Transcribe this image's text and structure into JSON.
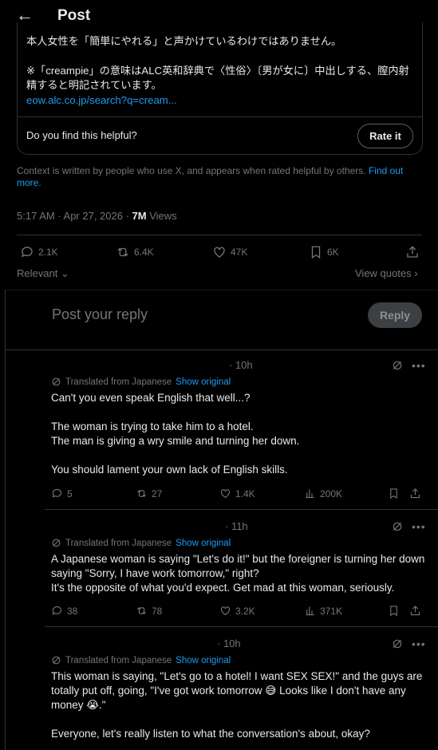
{
  "header": {
    "back_icon": "arrow-left-icon",
    "title": "Post"
  },
  "note": {
    "line1": "本人女性を「簡単にやれる」と声かけているわけではありません。",
    "line2": "※「creampie」の意味はALC英和辞典で〈性俗〉〔男が女に〕中出しする、膣内射精すると明記されています。",
    "link": "eow.alc.co.jp/search?q=cream...",
    "helpful_question": "Do you find this helpful?",
    "rate_label": "Rate it"
  },
  "context": {
    "text": "Context is written by people who use X, and appears when rated helpful by others.",
    "link": "Find out more."
  },
  "post": {
    "time": "5:17 AM · Apr 27, 2026 · ",
    "views_count": "7M",
    "views_label": " Views",
    "replies": "2.1K",
    "reposts": "6.4K",
    "likes": "47K",
    "bookmarks": "6K"
  },
  "sort": {
    "relevant": "Relevant",
    "view_quotes": "View quotes"
  },
  "reply_box": {
    "placeholder": "Post your reply",
    "button": "Reply"
  },
  "replies": [
    {
      "time": "· 10h",
      "translated_label": "Translated from Japanese",
      "show_original": "Show original",
      "text": "Can't you even speak English that well...?\n\nThe woman is trying to take him to a hotel.\nThe man is giving a wry smile and turning her down.\n\nYou should lament your own lack of English skills.",
      "replies": "5",
      "reposts": "27",
      "likes": "1.4K",
      "views": "200K"
    },
    {
      "time": "· 11h",
      "translated_label": "Translated from Japanese",
      "show_original": "Show original",
      "text": "A Japanese woman is saying \"Let's do it!\" but the foreigner is turning her down saying \"Sorry, I have work tomorrow,\" right?\nIt's the opposite of what you'd expect. Get mad at this woman, seriously.",
      "replies": "38",
      "reposts": "78",
      "likes": "3.2K",
      "views": "371K"
    },
    {
      "time": "· 10h",
      "translated_label": "Translated from Japanese",
      "show_original": "Show original",
      "text": "This woman is saying, \"Let's go to a hotel! I want SEX SEX!\" and the guys are totally put off, going, \"I've got work tomorrow 😅 Looks like I don't have any money 😭.\"\n\nEveryone, let's really listen to what the conversation's about, okay?"
    }
  ],
  "colors": {
    "accent": "#1d9bf0",
    "muted": "#71767b",
    "border": "#2f3336"
  }
}
